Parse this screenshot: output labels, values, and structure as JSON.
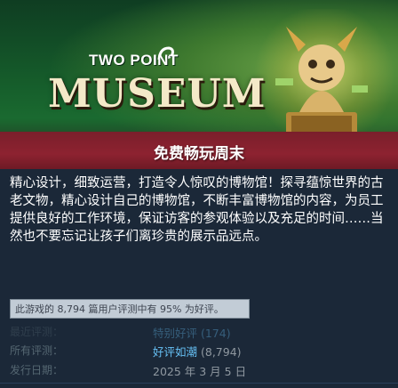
{
  "header": {
    "brand_small": "TWO POINT",
    "brand_large": "MUSEUM",
    "promo": "免费畅玩周末"
  },
  "description": "精心设计，细致运营，打造令人惊叹的博物馆！探寻蕴惊世界的古老文物，精心设计自己的博物馆，不断丰富博物馆的内容，为员工提供良好的工作环境，保证访客的参观体验以及充足的时间……当然也不要忘记让孩子们离珍贵的展示品远点。",
  "reviews": {
    "tooltip": "此游戏的 8,794 篇用户评测中有 95% 为好评。",
    "recent_label": "最近评测：",
    "recent_value": "特别好评 (174)",
    "all_label": "所有评测：",
    "all_summary": "好评如潮",
    "all_count": "(8,794)"
  },
  "release": {
    "label": "发行日期：",
    "date": "2025 年 3 月 5 日"
  }
}
